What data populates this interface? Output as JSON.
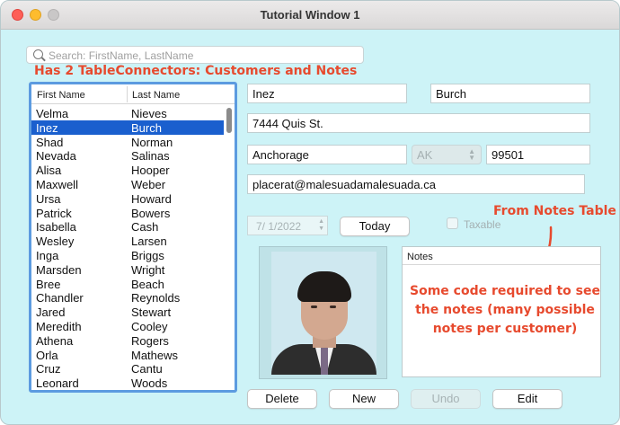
{
  "window": {
    "title": "Tutorial Window 1"
  },
  "search": {
    "placeholder": "Search: FirstName, LastName",
    "value": ""
  },
  "annotations": {
    "connectors": "Has 2 TableConnectors: Customers and Notes",
    "notes_table": "From Notes Table",
    "code_required": "Some code required to see the notes (many possible notes per customer)",
    "color": "#e74a2e"
  },
  "list": {
    "headers": [
      "First Name",
      "Last Name"
    ],
    "selected_index": 1,
    "rows": [
      [
        "Velma",
        "Nieves"
      ],
      [
        "Inez",
        "Burch"
      ],
      [
        "Shad",
        "Norman"
      ],
      [
        "Nevada",
        "Salinas"
      ],
      [
        "Alisa",
        "Hooper"
      ],
      [
        "Maxwell",
        "Weber"
      ],
      [
        "Ursa",
        "Howard"
      ],
      [
        "Patrick",
        "Bowers"
      ],
      [
        "Isabella",
        "Cash"
      ],
      [
        "Wesley",
        "Larsen"
      ],
      [
        "Inga",
        "Briggs"
      ],
      [
        "Marsden",
        "Wright"
      ],
      [
        "Bree",
        "Beach"
      ],
      [
        "Chandler",
        "Reynolds"
      ],
      [
        "Jared",
        "Stewart"
      ],
      [
        "Meredith",
        "Cooley"
      ],
      [
        "Athena",
        "Rogers"
      ],
      [
        "Orla",
        "Mathews"
      ],
      [
        "Cruz",
        "Cantu"
      ],
      [
        "Leonard",
        "Woods"
      ]
    ]
  },
  "form": {
    "first_name": "Inez",
    "last_name": "Burch",
    "address": "7444 Quis St.",
    "city": "Anchorage",
    "state": "AK",
    "zip": "99501",
    "email": "placerat@malesuadamalesuada.ca",
    "date": "7/  1/2022",
    "taxable_label": "Taxable",
    "taxable_checked": false
  },
  "buttons": {
    "today": "Today",
    "delete": "Delete",
    "new": "New",
    "undo": "Undo",
    "edit": "Edit"
  },
  "notes": {
    "header": "Notes"
  },
  "colors": {
    "window_bg": "#cdf3f7",
    "selection": "#1a5fce",
    "list_border": "#5c9be0"
  }
}
